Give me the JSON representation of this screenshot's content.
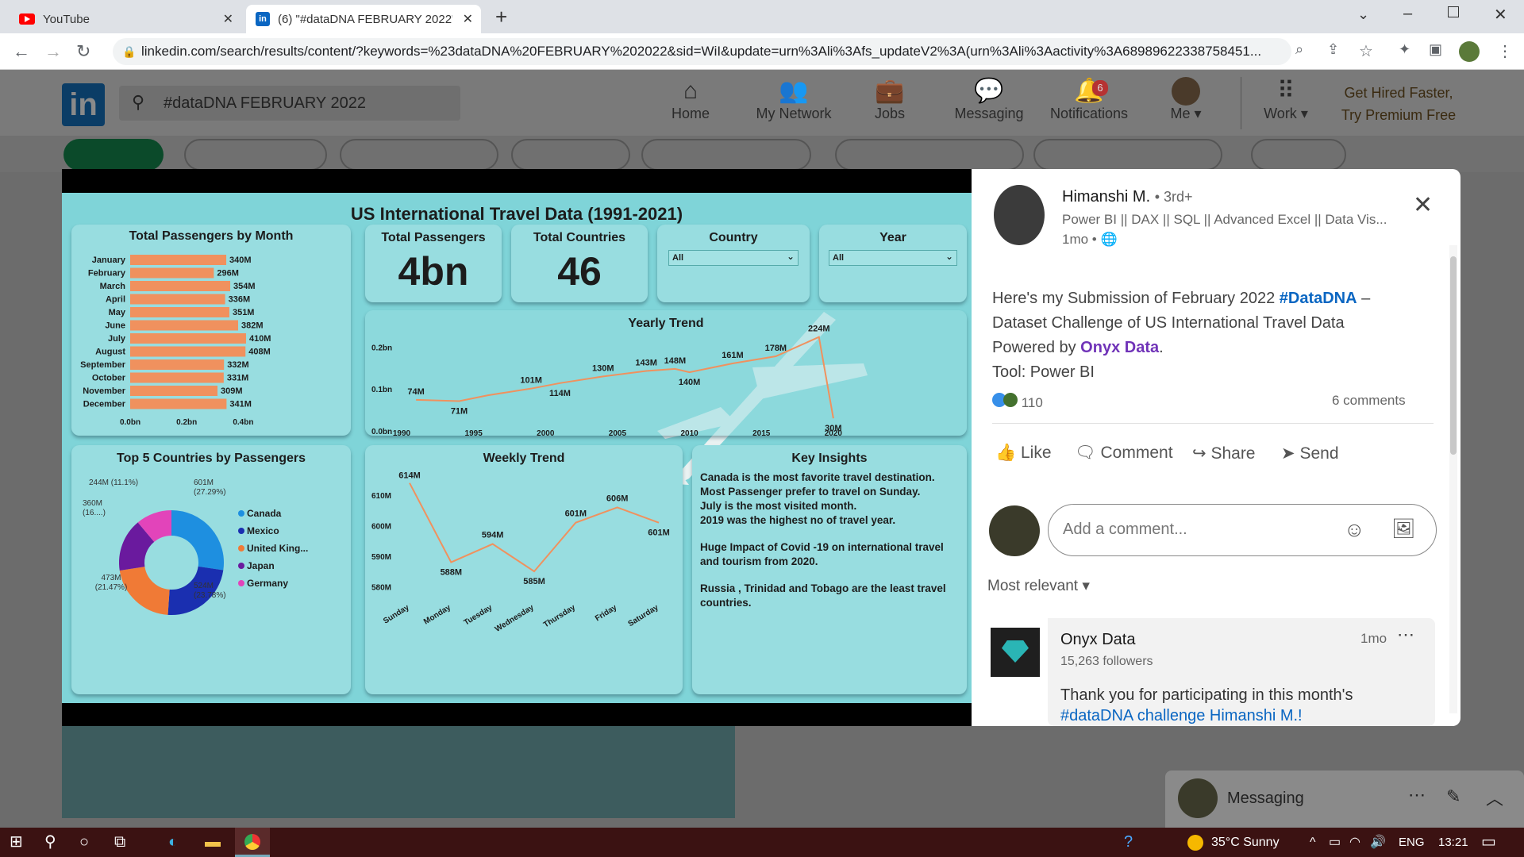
{
  "browser": {
    "tabs": [
      {
        "title": "YouTube"
      },
      {
        "title": "(6) \"#dataDNA FEBRUARY 2022\""
      }
    ],
    "url": "linkedin.com/search/results/content/?keywords=%23dataDNA%20FEBRUARY%202022&sid=WiI&update=urn%3Ali%3Afs_updateV2%3A(urn%3Ali%3Aactivity%3A68989622338758451..."
  },
  "linkedin": {
    "search_value": "#dataDNA FEBRUARY 2022",
    "nav": [
      {
        "label": "Home",
        "icon": "home-icon"
      },
      {
        "label": "My Network",
        "icon": "network-icon"
      },
      {
        "label": "Jobs",
        "icon": "briefcase-icon"
      },
      {
        "label": "Messaging",
        "icon": "chat-icon"
      },
      {
        "label": "Notifications",
        "icon": "bell-icon",
        "badge": "6"
      },
      {
        "label": "Me",
        "icon": "avatar"
      },
      {
        "label": "Work",
        "icon": "grid-icon"
      }
    ],
    "premium_line1": "Get Hired Faster,",
    "premium_line2": "Try Premium Free",
    "messaging_label": "Messaging"
  },
  "dashboard": {
    "title": "US International Travel Data (1991-2021)",
    "kpi_passengers_label": "Total Passengers",
    "kpi_passengers_value": "4bn",
    "kpi_countries_label": "Total Countries",
    "kpi_countries_value": "46",
    "filter_country_label": "Country",
    "filter_country_value": "All",
    "filter_year_label": "Year",
    "filter_year_value": "All",
    "insights_title": "Key Insights",
    "insights": [
      "Canada is the most favorite travel destination.",
      "Most Passenger prefer to travel on Sunday.",
      "July is the most visited month.",
      "2019 was the highest no of  travel year.",
      "Huge Impact of Covid -19 on international travel and tourism from 2020.",
      "Russia , Trinidad and Tobago are the least travel countries."
    ]
  },
  "chart_data": [
    {
      "type": "bar",
      "orientation": "horizontal",
      "title": "Total Passengers by Month",
      "categories": [
        "January",
        "February",
        "March",
        "April",
        "May",
        "June",
        "July",
        "August",
        "September",
        "October",
        "November",
        "December"
      ],
      "values": [
        340,
        296,
        354,
        336,
        351,
        382,
        410,
        408,
        332,
        331,
        309,
        341
      ],
      "labels": [
        "340M",
        "296M",
        "354M",
        "336M",
        "351M",
        "382M",
        "410M",
        "408M",
        "332M",
        "331M",
        "309M",
        "341M"
      ],
      "xticks": [
        "0.0bn",
        "0.2bn",
        "0.4bn"
      ],
      "xlim": [
        0,
        500
      ],
      "color": "#f0915e"
    },
    {
      "type": "line",
      "title": "Yearly Trend",
      "x": [
        1991,
        1994,
        1996,
        1999,
        2001,
        2004,
        2007,
        2009,
        2010,
        2013,
        2016,
        2019,
        2020
      ],
      "values": [
        74,
        71,
        85,
        101,
        114,
        130,
        143,
        148,
        140,
        161,
        178,
        224,
        30
      ],
      "labels": [
        "74M",
        "71M",
        "",
        "101M",
        "114M",
        "130M",
        "143M",
        "148M",
        "140M",
        "161M",
        "178M",
        "224M",
        "30M"
      ],
      "xticks": [
        "1990",
        "1995",
        "2000",
        "2005",
        "2010",
        "2015",
        "2020"
      ],
      "yticks": [
        "0.0bn",
        "0.1bn",
        "0.2bn"
      ],
      "ylim": [
        0,
        250
      ],
      "color": "#f0915e"
    },
    {
      "type": "pie",
      "donut": true,
      "title": "Top 5 Countries by Passengers",
      "series": [
        {
          "name": "Canada",
          "value": 601,
          "label": "601M",
          "pct": "(27.29%)",
          "color": "#1e8fe0"
        },
        {
          "name": "Mexico",
          "value": 524,
          "label": "524M",
          "pct": "(23.78%)",
          "color": "#1a2fb0"
        },
        {
          "name": "United King...",
          "value": 473,
          "label": "473M",
          "pct": "(21.47%)",
          "color": "#f07a36"
        },
        {
          "name": "Japan",
          "value": 360,
          "label": "360M",
          "pct": "(16....)",
          "color": "#6a1a9e"
        },
        {
          "name": "Germany",
          "value": 244,
          "label": "244M (11.1%)",
          "pct": "",
          "color": "#e244ba"
        }
      ]
    },
    {
      "type": "line",
      "title": "Weekly Trend",
      "categories": [
        "Sunday",
        "Monday",
        "Tuesday",
        "Wednesday",
        "Thursday",
        "Friday",
        "Saturday"
      ],
      "values": [
        614,
        588,
        594,
        585,
        601,
        606,
        601
      ],
      "labels": [
        "614M",
        "588M",
        "594M",
        "585M",
        "601M",
        "606M",
        "601M"
      ],
      "yticks": [
        "580M",
        "590M",
        "600M",
        "610M"
      ],
      "ylim": [
        578,
        616
      ],
      "color": "#f0915e"
    }
  ],
  "post": {
    "author": "Himanshi M.",
    "degree": "• 3rd+",
    "headline": "Power BI || DAX || SQL || Advanced Excel || Data Vis...",
    "time": "1mo •",
    "text_1": "Here's my Submission of February 2022 ",
    "hashtag": "#DataDNA",
    "text_2": " –",
    "text_3": "Dataset Challenge of US International Travel Data",
    "text_4": "Powered by ",
    "mention": "Onyx Data",
    "text_5": ".",
    "text_6": "Tool: Power BI",
    "reactions": "110",
    "comments_count": "6 comments",
    "actions": [
      "Like",
      "Comment",
      "Share",
      "Send"
    ],
    "comment_placeholder": "Add a comment...",
    "sort_label": "Most relevant",
    "comment_author": "Onyx Data",
    "comment_followers": "15,263 followers",
    "comment_time": "1mo",
    "comment_text": "Thank you for participating in this month's",
    "comment_text_2": "#dataDNA challenge Himanshi M.!"
  },
  "taskbar": {
    "weather": "35°C  Sunny",
    "lang": "ENG",
    "time": "13:21"
  }
}
